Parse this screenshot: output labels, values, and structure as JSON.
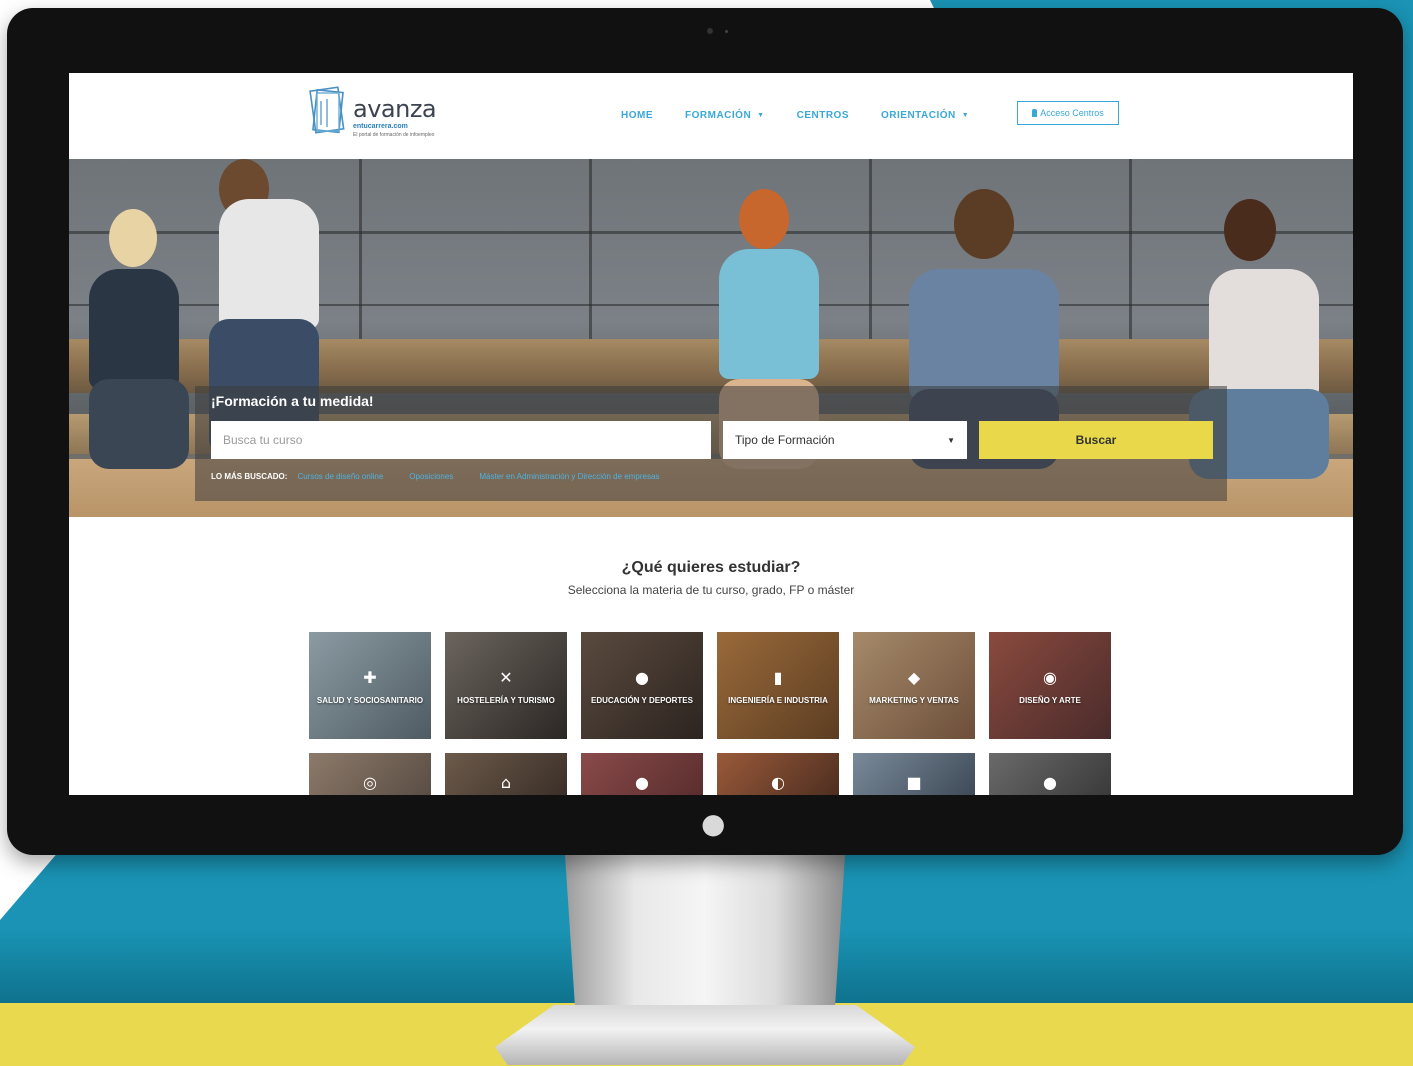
{
  "colors": {
    "accent": "#3aa7d9",
    "search_button": "#e8d84a",
    "teal_background": "#1a93b4",
    "yellow_band": "#e9d94e"
  },
  "header": {
    "logo": {
      "name": "avanza",
      "domain": "entucarrera.com",
      "tagline": "El portal de formación de infoempleo"
    },
    "nav": [
      {
        "label": "HOME",
        "has_dropdown": false
      },
      {
        "label": "FORMACIÓN",
        "has_dropdown": true
      },
      {
        "label": "CENTROS",
        "has_dropdown": false
      },
      {
        "label": "ORIENTACIÓN",
        "has_dropdown": true
      }
    ],
    "access_button": "Acceso Centros"
  },
  "hero": {
    "title": "¡Formación a tu medida!",
    "search_placeholder": "Busca tu curso",
    "type_select": "Tipo de Formación",
    "search_button": "Buscar",
    "popular_label": "LO MÁS BUSCADO:",
    "popular_links": [
      "Cursos de diseño online",
      "Oposiciones",
      "Máster en Administración y Dirección de empresas"
    ]
  },
  "study": {
    "title": "¿Qué quieres estudiar?",
    "subtitle": "Selecciona la materia de tu curso, grado, FP o máster",
    "categories": [
      {
        "label": "SALUD Y SOCIOSANITARIO",
        "icon": "medical-cross-icon"
      },
      {
        "label": "HOSTELERÍA Y TURISMO",
        "icon": "fork-knife-icon"
      },
      {
        "label": "EDUCACIÓN Y DEPORTES",
        "icon": "medal-icon"
      },
      {
        "label": "INGENIERÍA E INDUSTRIA",
        "icon": "factory-icon"
      },
      {
        "label": "MARKETING Y VENTAS",
        "icon": "price-tag-icon"
      },
      {
        "label": "DISEÑO Y ARTE",
        "icon": "camera-icon"
      }
    ],
    "second_row_icons": [
      "globe-icon",
      "house-icon",
      "person-icon",
      "glasses-icon",
      "briefcase-icon",
      "chat-icon"
    ]
  }
}
